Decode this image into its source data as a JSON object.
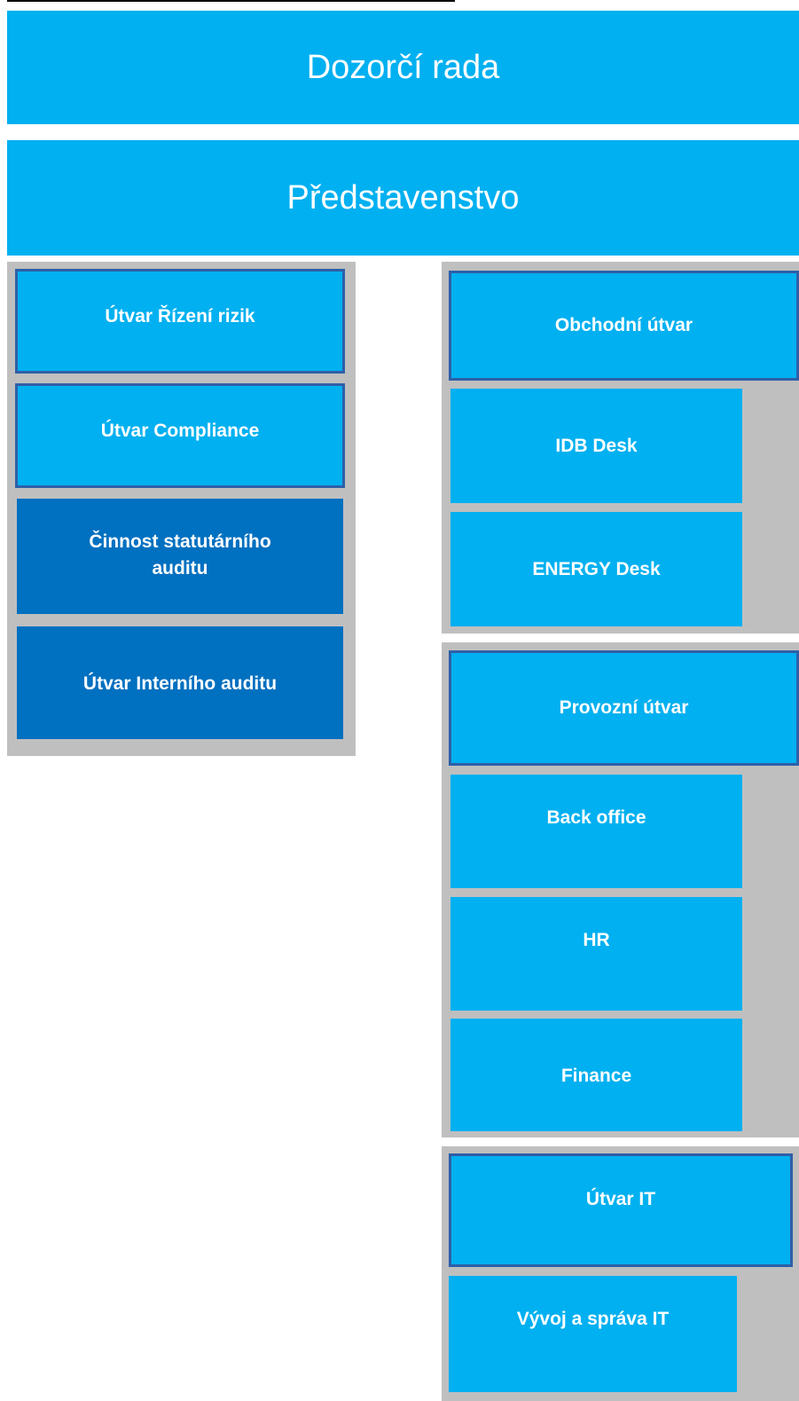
{
  "governance": {
    "supervisory_board": "Dozorčí rada",
    "board_of_directors": "Představenstvo"
  },
  "left_group": {
    "units": [
      "Útvar Řízení rizik",
      "Útvar Compliance",
      "Činnost statutárního auditu",
      "Útvar Interního auditu"
    ]
  },
  "business_group": {
    "head": "Obchodní útvar",
    "units": [
      "IDB Desk",
      "ENERGY Desk"
    ]
  },
  "operations_group": {
    "head": "Provozní útvar",
    "units": [
      "Back office",
      "HR",
      "Finance"
    ]
  },
  "it_group": {
    "head": "Útvar IT",
    "units": [
      "Vývoj a správa IT"
    ]
  },
  "colors": {
    "box_fill": "#00b0f0",
    "audit_fill": "#0070c0",
    "panel_gray": "#bfbfbf",
    "outline": "#2e5fa7",
    "text": "#ffffff"
  }
}
